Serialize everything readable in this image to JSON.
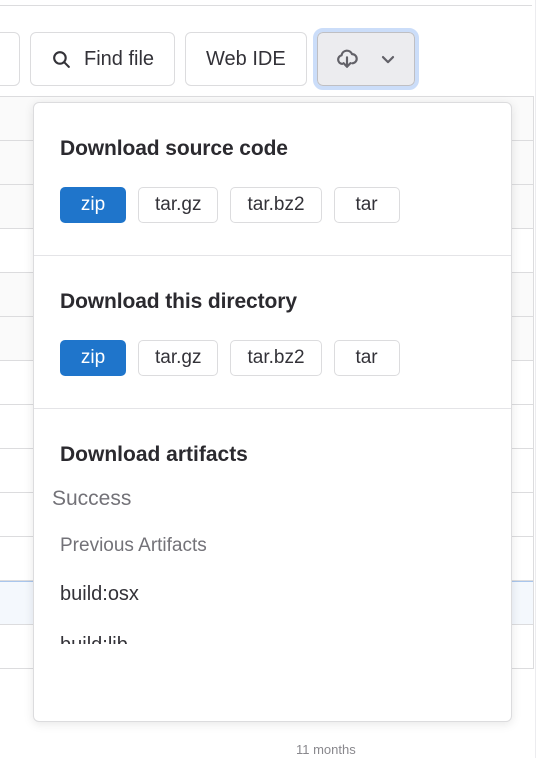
{
  "toolbar": {
    "partial_button": {
      "icon": "chevron-down-icon",
      "label": ""
    },
    "find_file": {
      "label": "Find file",
      "icon": "search-icon"
    },
    "web_ide": {
      "label": "Web IDE"
    },
    "download_split": {
      "icon": "cloud-download-icon",
      "caret_icon": "chevron-down-icon",
      "expanded": true
    }
  },
  "dropdown": {
    "sections": [
      {
        "id": "source-code",
        "title": "Download source code",
        "formats": [
          {
            "label": "zip",
            "selected": true
          },
          {
            "label": "tar.gz",
            "selected": false
          },
          {
            "label": "tar.bz2",
            "selected": false
          },
          {
            "label": "tar",
            "selected": false
          }
        ]
      },
      {
        "id": "this-directory",
        "title": "Download this directory",
        "formats": [
          {
            "label": "zip",
            "selected": true
          },
          {
            "label": "tar.gz",
            "selected": false
          },
          {
            "label": "tar.bz2",
            "selected": false
          },
          {
            "label": "tar",
            "selected": false
          }
        ]
      }
    ],
    "artifacts": {
      "title": "Download artifacts",
      "status": "Success",
      "group_label": "Previous Artifacts",
      "items": [
        {
          "label": "build:osx"
        },
        {
          "label": "build:lib"
        }
      ]
    }
  },
  "background": {
    "footer_text": "11 months",
    "truncated_item": "build:lib"
  },
  "colors": {
    "accent": "#1f75cb",
    "border": "#dcdcde",
    "muted_text": "#737278",
    "text": "#333238",
    "focus_ring": "#cbddf9",
    "selected_row": "#f4f8fd"
  }
}
